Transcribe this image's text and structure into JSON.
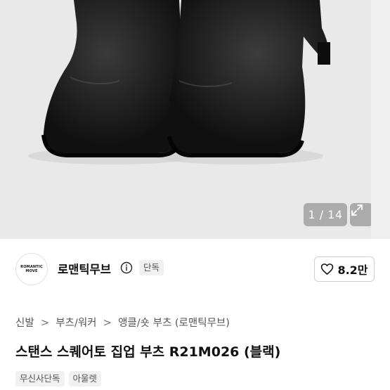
{
  "gallery": {
    "counter": "1 / 14",
    "expand_icon": "expand-arrows-icon"
  },
  "brand": {
    "logo_line1": "ROMANTIC",
    "logo_line2": "MOVE",
    "name": "로맨틱무브",
    "info_icon": "info-icon",
    "exclusive_badge": "단독"
  },
  "like": {
    "icon": "heart-outline-icon",
    "count": "8.2만"
  },
  "breadcrumb": {
    "items": [
      "신발",
      "부츠/워커",
      "앵클/숏 부츠 (로맨틱무브)"
    ],
    "separator": ">"
  },
  "product": {
    "title": "스탠스 스퀘어토 집업 부츠 R21M026 (블랙)"
  },
  "tags": [
    "무신사단독",
    "아울렛"
  ],
  "colors": {
    "hero_bg": "#e9e9e9",
    "boot": "#141414",
    "badge_bg": "#f1f1f1"
  }
}
